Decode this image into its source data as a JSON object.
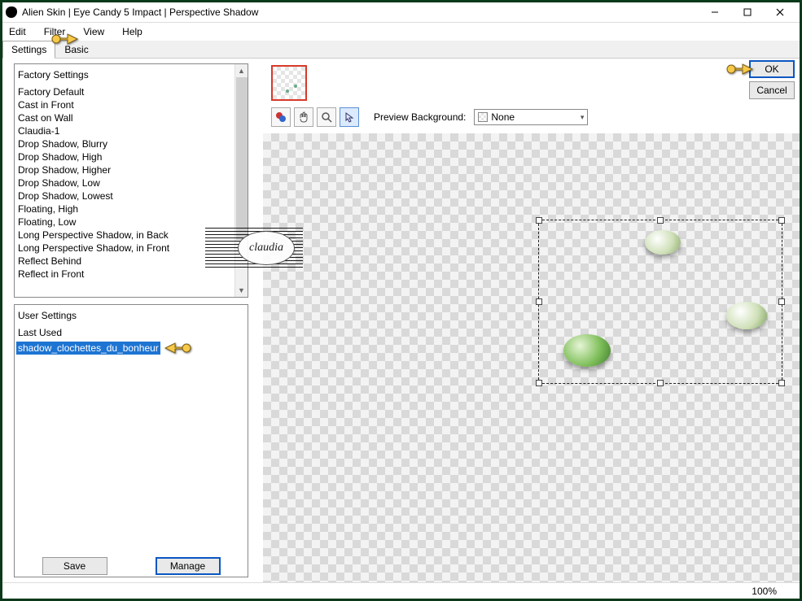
{
  "window": {
    "title": "Alien Skin | Eye Candy 5 Impact | Perspective Shadow"
  },
  "menu": {
    "edit": "Edit",
    "filter": "Filter",
    "view": "View",
    "help": "Help"
  },
  "tabs": {
    "settings": "Settings",
    "basic": "Basic"
  },
  "factory": {
    "header": "Factory Settings",
    "items": [
      "Factory Default",
      "Cast in Front",
      "Cast on Wall",
      "Claudia-1",
      "Drop Shadow, Blurry",
      "Drop Shadow, High",
      "Drop Shadow, Higher",
      "Drop Shadow, Low",
      "Drop Shadow, Lowest",
      "Floating, High",
      "Floating, Low",
      "Long Perspective Shadow, in Back",
      "Long Perspective Shadow, in Front",
      "Reflect Behind",
      "Reflect in Front"
    ]
  },
  "user": {
    "header": "User Settings",
    "items": [
      {
        "label": "Last Used",
        "selected": false
      },
      {
        "label": "shadow_clochettes_du_bonheur",
        "selected": true
      }
    ]
  },
  "buttons": {
    "save": "Save",
    "manage": "Manage",
    "ok": "OK",
    "cancel": "Cancel"
  },
  "preview": {
    "label": "Preview Background:",
    "value": "None"
  },
  "status": {
    "zoom": "100%"
  },
  "watermark": {
    "text": "claudia"
  }
}
